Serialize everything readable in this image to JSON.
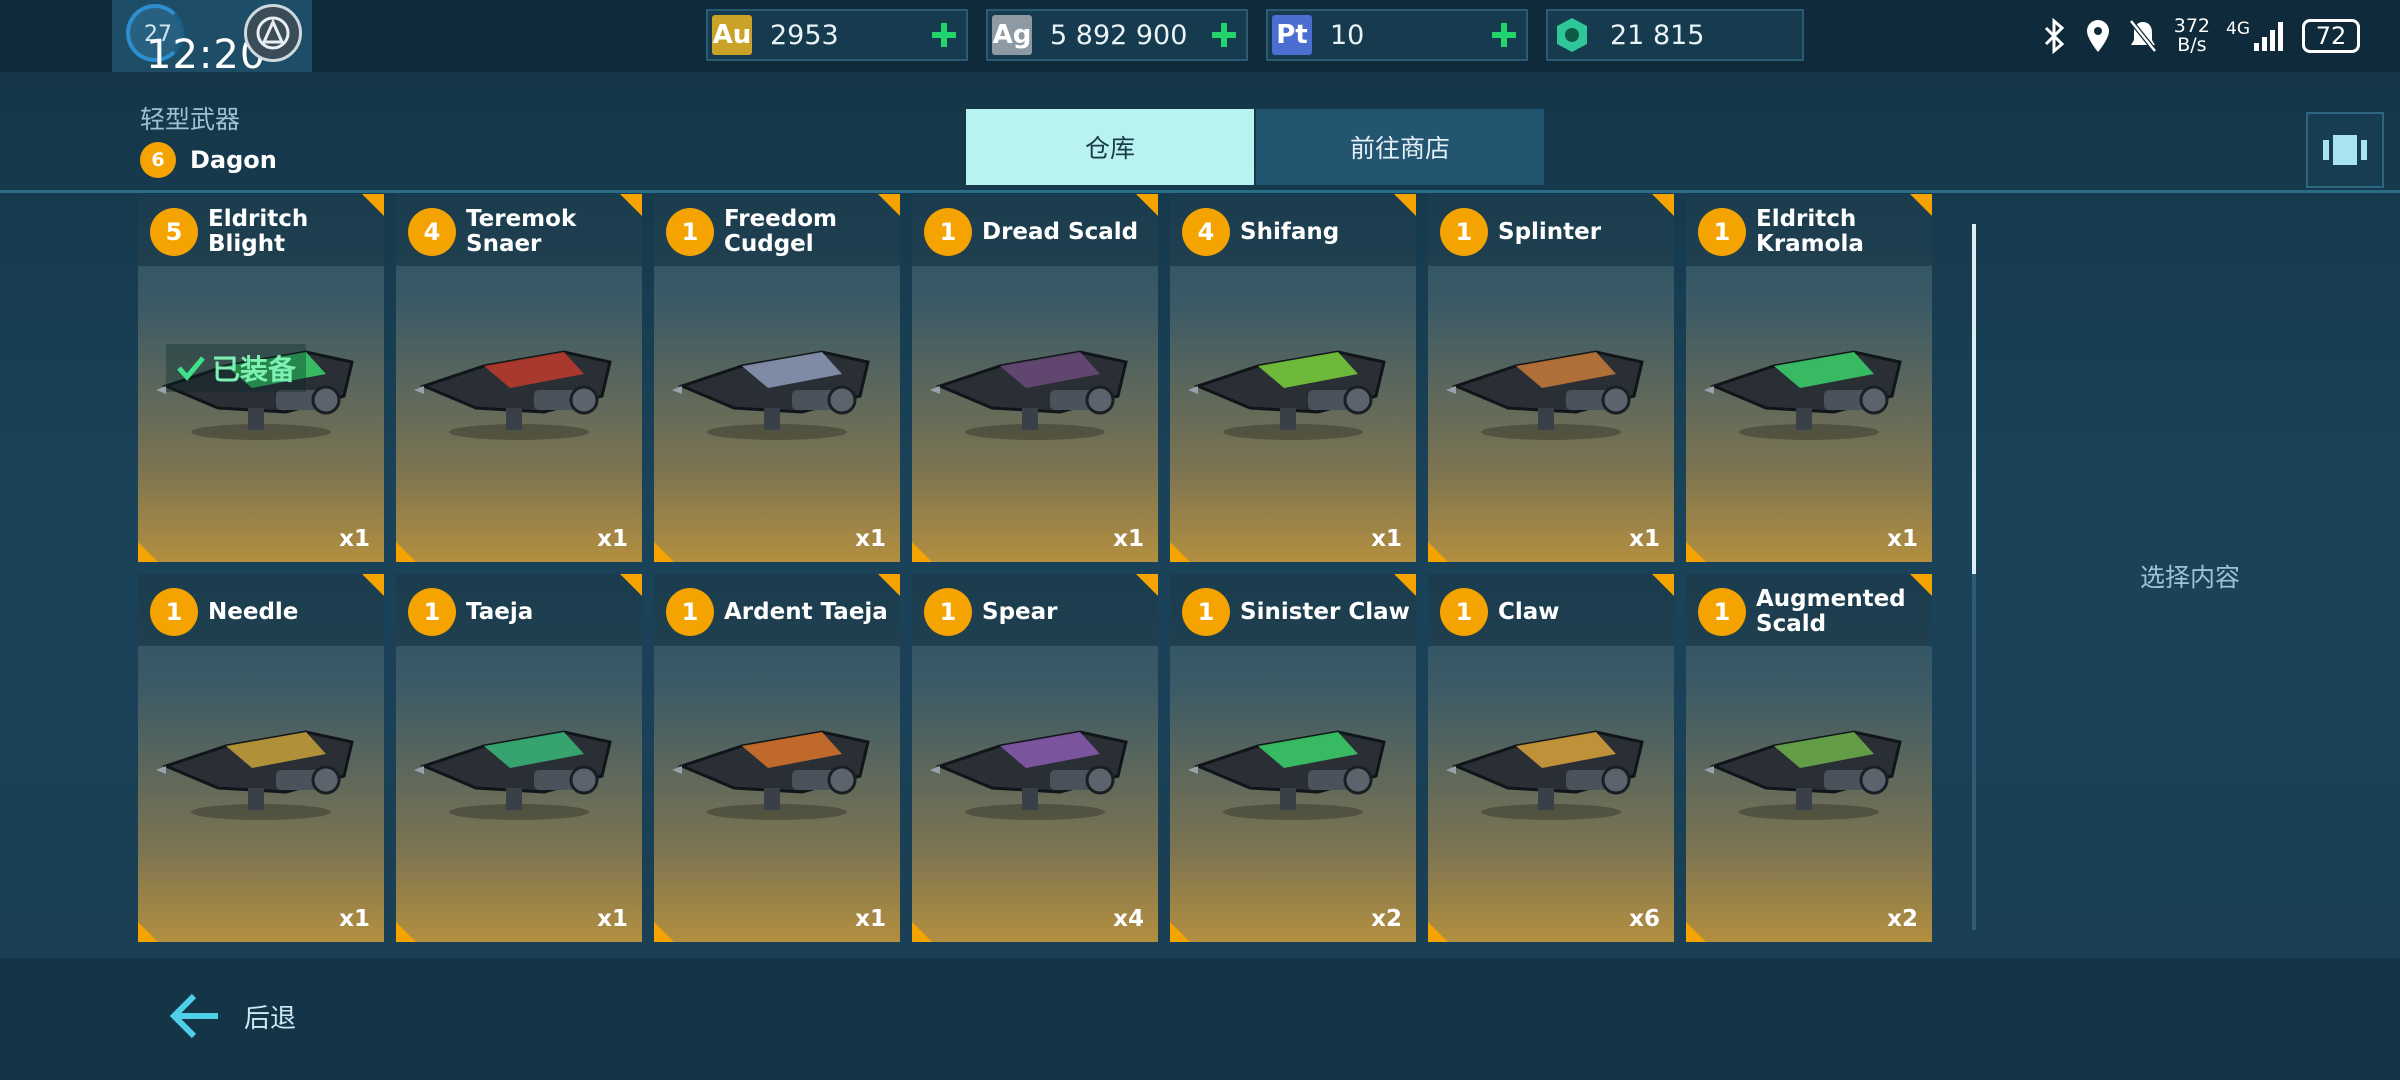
{
  "status_bar": {
    "level": "27",
    "time": "12:20",
    "net_speed_value": "372",
    "net_speed_unit": "B/s",
    "network": "4G",
    "battery": "72"
  },
  "currencies": [
    {
      "code": "Au",
      "value": "2953",
      "color": "#c9a227"
    },
    {
      "code": "Ag",
      "value": "5 892 900",
      "color": "#8e9aa3"
    },
    {
      "code": "Pt",
      "value": "10",
      "color": "#4a6fd0"
    },
    {
      "code": "gem",
      "value": "21 815",
      "color": "#2fc79a"
    }
  ],
  "header": {
    "category": "轻型武器",
    "ship_level": "6",
    "ship_name": "Dagon"
  },
  "tabs": {
    "warehouse": "仓库",
    "shop": "前往商店"
  },
  "weapons": [
    {
      "level": "5",
      "name": "Eldritch Blight",
      "qty": "x1",
      "color": "#3ad26a",
      "equipped": true
    },
    {
      "level": "4",
      "name": "Teremok Snaer",
      "qty": "x1",
      "color": "#c0392b"
    },
    {
      "level": "1",
      "name": "Freedom Cudgel",
      "qty": "x1",
      "color": "#8e9ab8"
    },
    {
      "level": "1",
      "name": "Dread Scald",
      "qty": "x1",
      "color": "#6b4a7a"
    },
    {
      "level": "4",
      "name": "Shifang",
      "qty": "x1",
      "color": "#7ad13a"
    },
    {
      "level": "1",
      "name": "Splinter",
      "qty": "x1",
      "color": "#c87a3a"
    },
    {
      "level": "1",
      "name": "Eldritch Kramola",
      "qty": "x1",
      "color": "#3ad26a"
    },
    {
      "level": "1",
      "name": "Needle",
      "qty": "x1",
      "color": "#c8a23a"
    },
    {
      "level": "1",
      "name": "Taeja",
      "qty": "x1",
      "color": "#3ab87a"
    },
    {
      "level": "1",
      "name": "Ardent Taeja",
      "qty": "x1",
      "color": "#d9742a"
    },
    {
      "level": "1",
      "name": "Spear",
      "qty": "x4",
      "color": "#8a5ab0"
    },
    {
      "level": "1",
      "name": "Sinister Claw",
      "qty": "x2",
      "color": "#3ad26a"
    },
    {
      "level": "1",
      "name": "Claw",
      "qty": "x6",
      "color": "#d9a23a"
    },
    {
      "level": "1",
      "name": "Augmented Scald",
      "qty": "x2",
      "color": "#6fb04a"
    }
  ],
  "equipped_label": "已装备",
  "side_panel": {
    "placeholder": "选择内容"
  },
  "footer": {
    "back_label": "后退"
  }
}
